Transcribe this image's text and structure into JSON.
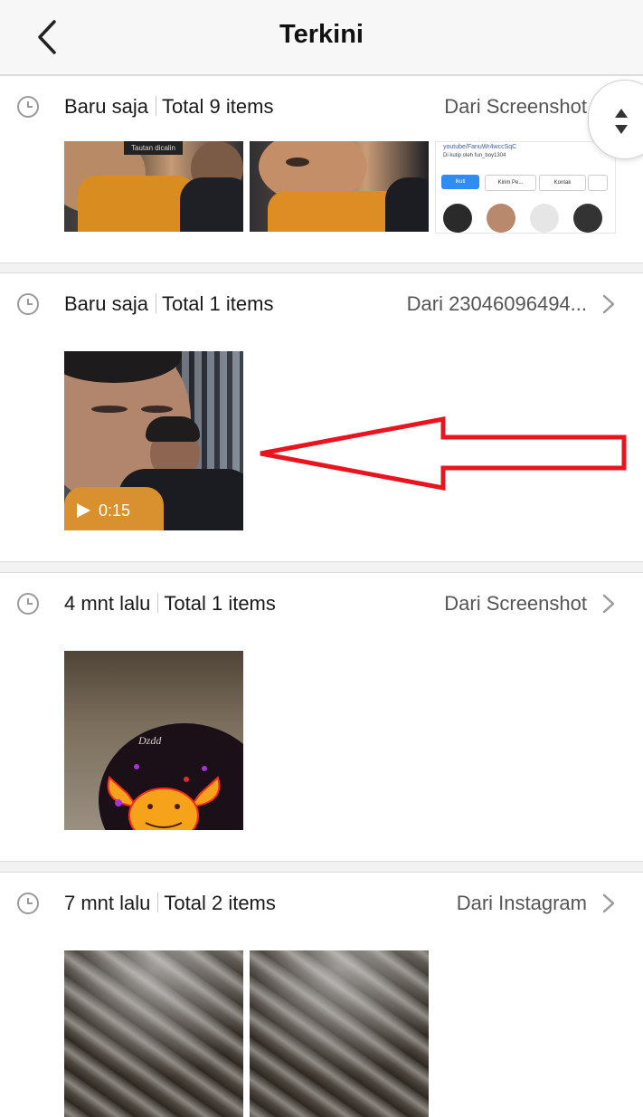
{
  "header": {
    "title": "Terkini",
    "back_icon": "chevron-left-icon"
  },
  "sections": [
    {
      "time": "Baru saja",
      "total": "Total 9 items",
      "source": "Dari Screenshot",
      "thumbs": [
        {
          "kind": "photo",
          "caption": "Tautan dicalin"
        },
        {
          "kind": "photo"
        },
        {
          "kind": "screenshot",
          "text": "youtube/FanuWr4wccSqC",
          "subtext": "Di kutip oleh fun_boy1304",
          "tabs": [
            "Ikuti",
            "Kirim Pe...",
            "Kontak"
          ]
        }
      ]
    },
    {
      "time": "Baru saja",
      "total": "Total 1 items",
      "source": "Dari 23046096494...",
      "thumbs": [
        {
          "kind": "video",
          "duration": "0:15"
        }
      ]
    },
    {
      "time": "4 mnt lalu",
      "total": "Total 1 items",
      "source": "Dari Screenshot",
      "thumbs": [
        {
          "kind": "photo",
          "text": "Dzdd"
        }
      ]
    },
    {
      "time": "7 mnt lalu",
      "total": "Total 2 items",
      "source": "Dari Instagram",
      "thumbs": [
        {
          "kind": "photo"
        },
        {
          "kind": "photo"
        }
      ]
    }
  ],
  "colors": {
    "annotation_arrow": "#e8141f",
    "background": "#f2f2f2",
    "card": "#ffffff"
  }
}
